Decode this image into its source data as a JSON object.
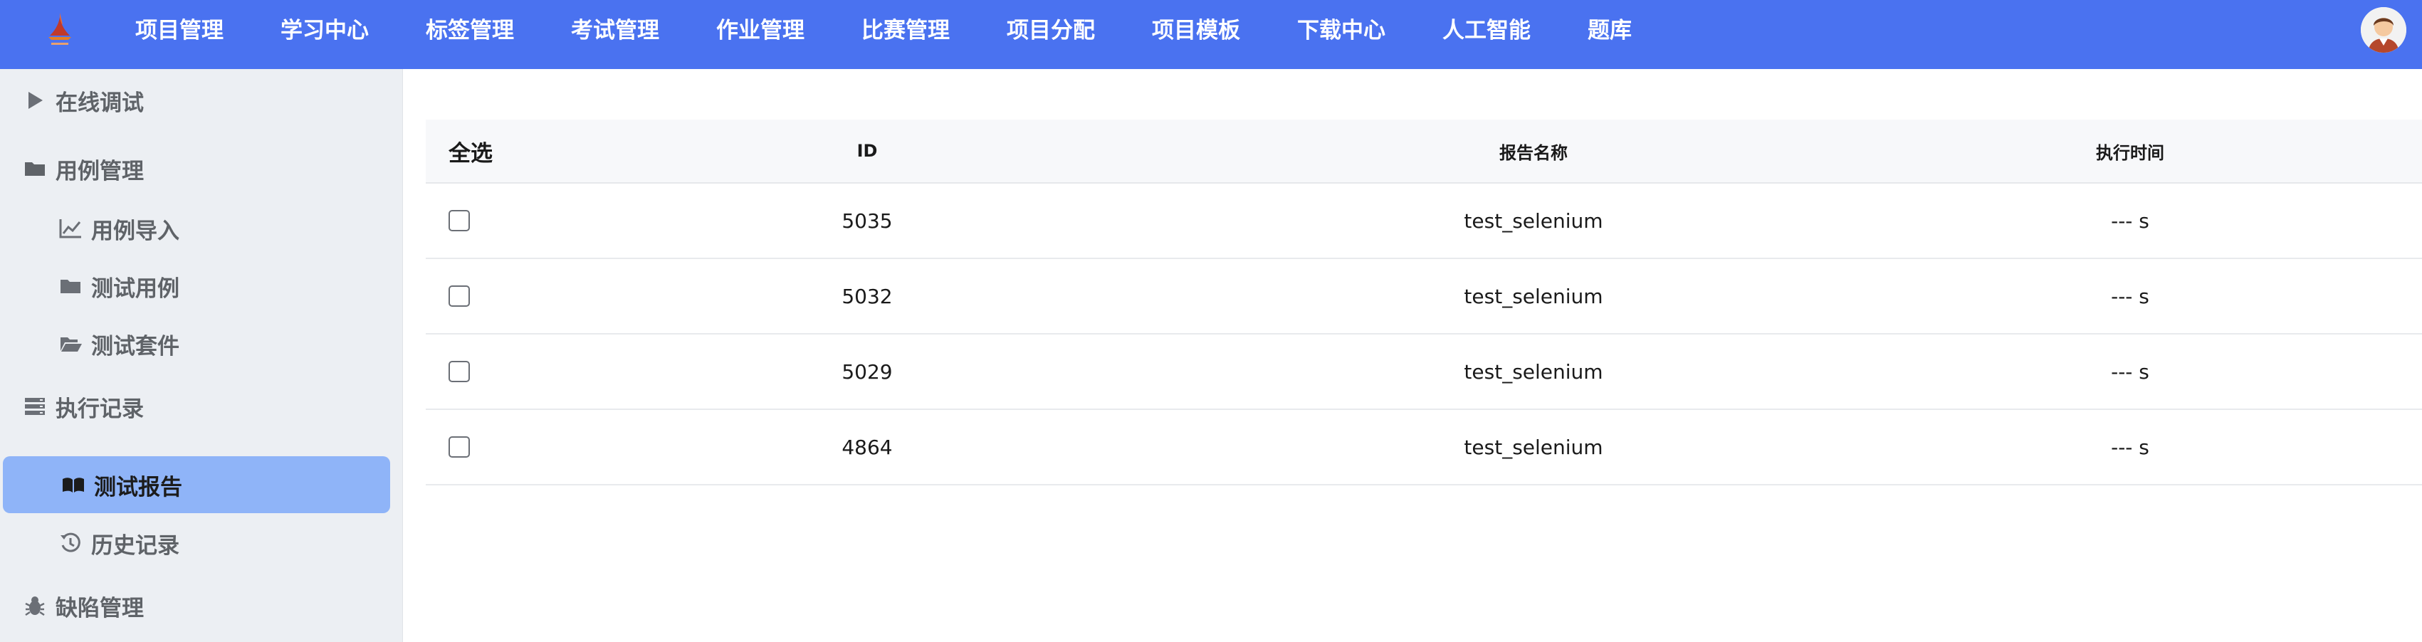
{
  "nav": {
    "items": [
      "项目管理",
      "学习中心",
      "标签管理",
      "考试管理",
      "作业管理",
      "比赛管理",
      "项目分配",
      "项目模板",
      "下载中心",
      "人工智能",
      "题库"
    ]
  },
  "sidebar": {
    "items": [
      {
        "label": "在线调试",
        "icon": "play-icon",
        "level": 1
      },
      {
        "label": "用例管理",
        "icon": "folder-icon",
        "level": 1
      },
      {
        "label": "用例导入",
        "icon": "chart-line-icon",
        "level": 2
      },
      {
        "label": "测试用例",
        "icon": "folder-icon",
        "level": 2
      },
      {
        "label": "测试套件",
        "icon": "folder-open-icon",
        "level": 2
      },
      {
        "label": "执行记录",
        "icon": "server-icon",
        "level": 1
      },
      {
        "label": "测试报告",
        "icon": "book-open-icon",
        "level": 2,
        "active": true
      },
      {
        "label": "历史记录",
        "icon": "history-icon",
        "level": 2
      },
      {
        "label": "缺陷管理",
        "icon": "bug-icon",
        "level": 1
      }
    ]
  },
  "table": {
    "headers": {
      "select_all": "全选",
      "id": "ID",
      "name": "报告名称",
      "time": "执行时间"
    },
    "rows": [
      {
        "id": "5035",
        "name": "test_selenium",
        "time": "--- s"
      },
      {
        "id": "5032",
        "name": "test_selenium",
        "time": "--- s"
      },
      {
        "id": "5029",
        "name": "test_selenium",
        "time": "--- s"
      },
      {
        "id": "4864",
        "name": "test_selenium",
        "time": "--- s"
      }
    ]
  },
  "colors": {
    "topbar": "#4a72f0",
    "sidebar_bg": "#eceff3",
    "active_item": "#8fb4f8"
  }
}
